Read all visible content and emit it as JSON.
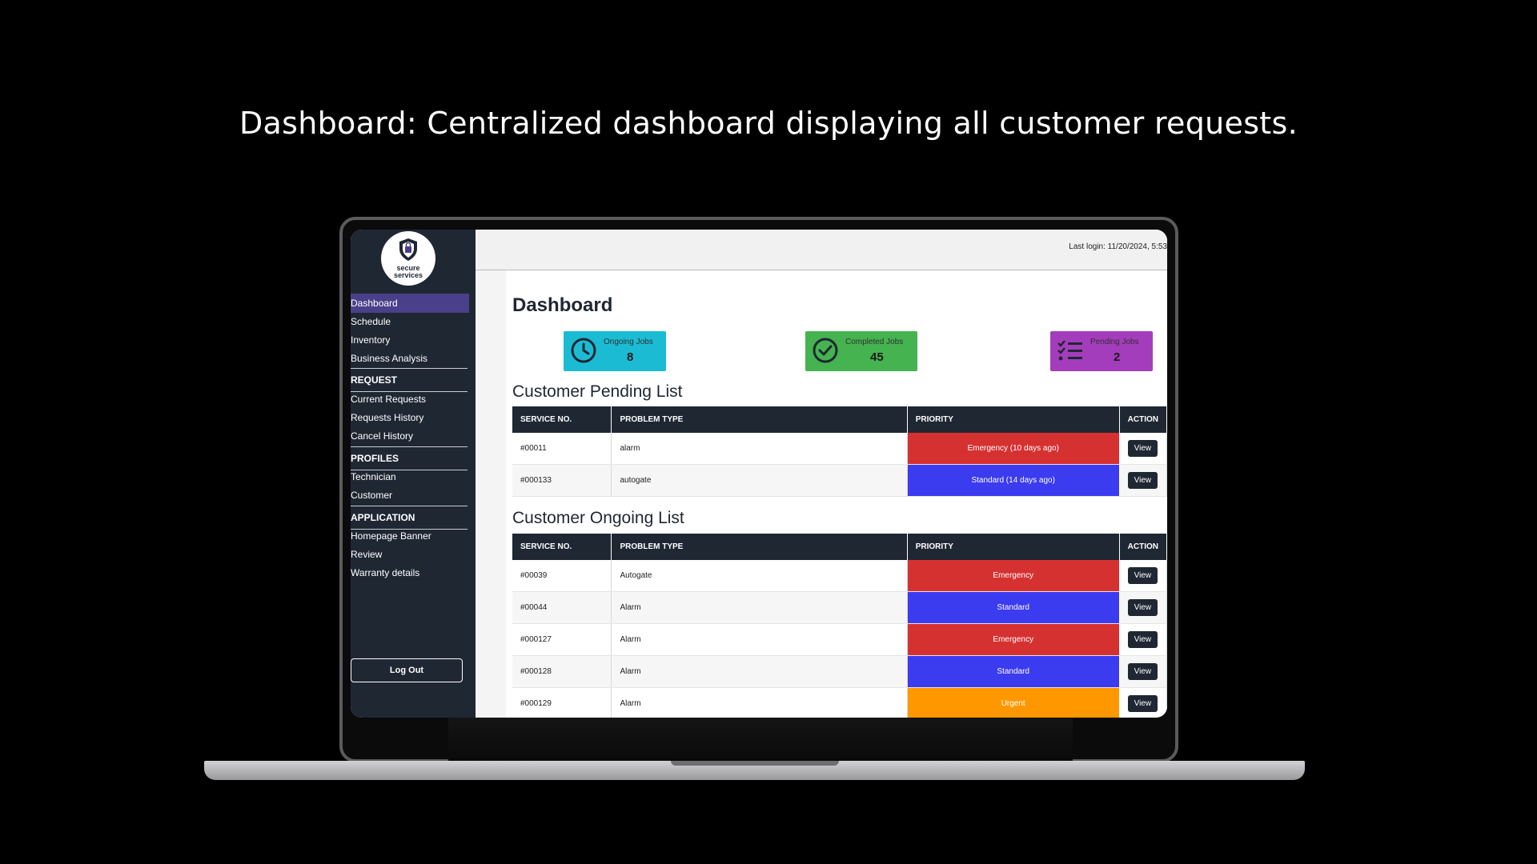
{
  "headline": "Dashboard: Centralized dashboard displaying all customer requests.",
  "logo": {
    "line1": "secure",
    "line2": "services"
  },
  "sidebar": {
    "items": [
      {
        "label": "Dashboard",
        "active": true
      },
      {
        "label": "Schedule"
      },
      {
        "label": "Inventory"
      },
      {
        "label": "Business Analysis"
      }
    ],
    "sections": {
      "request": {
        "title": "REQUEST",
        "items": [
          "Current Requests",
          "Requests History",
          "Cancel History"
        ]
      },
      "profiles": {
        "title": "PROFILES",
        "items": [
          "Technician",
          "Customer"
        ]
      },
      "application": {
        "title": "APPLICATION",
        "items": [
          "Homepage Banner",
          "Review",
          "Warranty details"
        ]
      }
    },
    "logout": "Log Out"
  },
  "topbar": {
    "last_login": "Last login: 11/20/2024, 5:53"
  },
  "page_title": "Dashboard",
  "cards": {
    "ongoing": {
      "label": "Ongoing Jobs",
      "value": "8",
      "color": "#1bbcd3"
    },
    "completed": {
      "label": "Completed Jobs",
      "value": "45",
      "color": "#45b34f"
    },
    "pending": {
      "label": "Pending Jobs",
      "value": "2",
      "color": "#a43dbb"
    }
  },
  "columns": [
    "SERVICE NO.",
    "PROBLEM TYPE",
    "PRIORITY",
    "ACTION"
  ],
  "priority_colors": {
    "Emergency": "#d63131",
    "Standard": "#3b3bf0",
    "Urgent": "#ff9800"
  },
  "pending_list": {
    "title": "Customer Pending List",
    "rows": [
      {
        "service_no": "#00011",
        "problem": "alarm",
        "priority": "Emergency (10 days ago)",
        "level": "Emergency",
        "action": "View"
      },
      {
        "service_no": "#000133",
        "problem": "autogate",
        "priority": "Standard (14 days ago)",
        "level": "Standard",
        "action": "View"
      }
    ]
  },
  "ongoing_list": {
    "title": "Customer Ongoing List",
    "rows": [
      {
        "service_no": "#00039",
        "problem": "Autogate",
        "priority": "Emergency",
        "level": "Emergency",
        "action": "View"
      },
      {
        "service_no": "#00044",
        "problem": "Alarm",
        "priority": "Standard",
        "level": "Standard",
        "action": "View"
      },
      {
        "service_no": "#000127",
        "problem": "Alarm",
        "priority": "Emergency",
        "level": "Emergency",
        "action": "View"
      },
      {
        "service_no": "#000128",
        "problem": "Alarm",
        "priority": "Standard",
        "level": "Standard",
        "action": "View"
      },
      {
        "service_no": "#000129",
        "problem": "Alarm",
        "priority": "Urgent",
        "level": "Urgent",
        "action": "View"
      }
    ]
  }
}
